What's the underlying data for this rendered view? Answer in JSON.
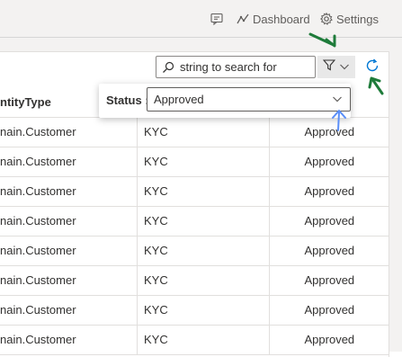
{
  "header": {
    "dashboard_label": "Dashboard",
    "settings_label": "Settings"
  },
  "toolbar": {
    "search_placeholder": "string to search for"
  },
  "filter": {
    "status_label": "Status :",
    "status_value": "Approved"
  },
  "table": {
    "headers": [
      "ntityType",
      "",
      ""
    ],
    "rows": [
      [
        "nain.Customer",
        "KYC",
        "Approved"
      ],
      [
        "nain.Customer",
        "KYC",
        "Approved"
      ],
      [
        "nain.Customer",
        "KYC",
        "Approved"
      ],
      [
        "nain.Customer",
        "KYC",
        "Approved"
      ],
      [
        "nain.Customer",
        "KYC",
        "Approved"
      ],
      [
        "nain.Customer",
        "KYC",
        "Approved"
      ],
      [
        "nain.Customer",
        "KYC",
        "Approved"
      ],
      [
        "nain.Customer",
        "KYC",
        "Approved"
      ]
    ]
  },
  "colors": {
    "accent": "#0078d4",
    "annotation_green": "#1e7b3a",
    "annotation_blue": "#5b8ff9"
  }
}
